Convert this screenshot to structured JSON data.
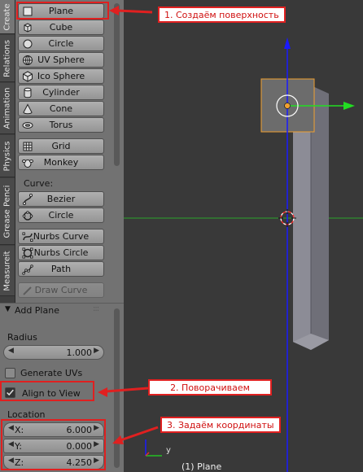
{
  "tabs": [
    "Create",
    "Relations",
    "Animation",
    "Physics",
    "Grease Penci",
    "Measureit"
  ],
  "create": {
    "mesh_buttons": [
      {
        "label": "Plane",
        "icon": "plane-icon"
      },
      {
        "label": "Cube",
        "icon": "cube-icon"
      },
      {
        "label": "Circle",
        "icon": "circle-icon"
      },
      {
        "label": "UV Sphere",
        "icon": "uv-sphere-icon"
      },
      {
        "label": "Ico Sphere",
        "icon": "ico-sphere-icon"
      },
      {
        "label": "Cylinder",
        "icon": "cylinder-icon"
      },
      {
        "label": "Cone",
        "icon": "cone-icon"
      },
      {
        "label": "Torus",
        "icon": "torus-icon"
      }
    ],
    "misc_buttons": [
      {
        "label": "Grid",
        "icon": "grid-icon"
      },
      {
        "label": "Monkey",
        "icon": "monkey-icon"
      }
    ],
    "curve_label": "Curve:",
    "curve_buttons": [
      {
        "label": "Bezier",
        "icon": "bezier-icon"
      },
      {
        "label": "Circle",
        "icon": "curve-circle-icon"
      }
    ],
    "nurbs_buttons": [
      {
        "label": "Nurbs Curve",
        "icon": "nurbs-curve-icon"
      },
      {
        "label": "Nurbs Circle",
        "icon": "nurbs-circle-icon"
      },
      {
        "label": "Path",
        "icon": "path-icon"
      }
    ],
    "draw_curve_label": "Draw Curve"
  },
  "add_plane": {
    "title": "Add Plane",
    "radius_label": "Radius",
    "radius_value": "1.000",
    "generate_uvs_label": "Generate UVs",
    "generate_uvs": false,
    "align_to_view_label": "Align to View",
    "align_to_view": true,
    "location_label": "Location",
    "location": [
      {
        "axis": "X:",
        "value": "6.000"
      },
      {
        "axis": "Y:",
        "value": "0.000"
      },
      {
        "axis": "Z:",
        "value": "4.250"
      }
    ]
  },
  "viewport": {
    "object_label": "(1) Plane",
    "axis_label": "y"
  },
  "annotations": [
    "1. Создаём поверхность",
    "2. Поворачиваем",
    "3. Задаём координаты"
  ],
  "colors": {
    "annotation": "#e02020",
    "selection": "#f0a030",
    "x_axis": "#22dd22",
    "z_axis": "#1a1aff"
  }
}
